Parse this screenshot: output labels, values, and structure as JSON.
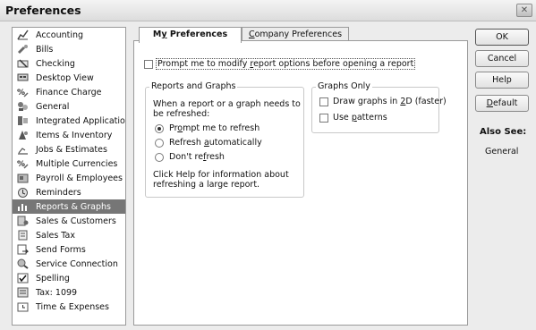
{
  "window": {
    "title": "Preferences",
    "close_glyph": "✕"
  },
  "sidebar": {
    "items": [
      {
        "label": "Accounting",
        "icon": "accounting-icon"
      },
      {
        "label": "Bills",
        "icon": "bills-icon"
      },
      {
        "label": "Checking",
        "icon": "checking-icon"
      },
      {
        "label": "Desktop View",
        "icon": "desktop-view-icon"
      },
      {
        "label": "Finance Charge",
        "icon": "finance-charge-icon"
      },
      {
        "label": "General",
        "icon": "general-icon"
      },
      {
        "label": "Integrated Applications",
        "icon": "integrated-apps-icon"
      },
      {
        "label": "Items & Inventory",
        "icon": "items-inventory-icon"
      },
      {
        "label": "Jobs & Estimates",
        "icon": "jobs-estimates-icon"
      },
      {
        "label": "Multiple Currencies",
        "icon": "currencies-icon"
      },
      {
        "label": "Payroll & Employees",
        "icon": "payroll-icon"
      },
      {
        "label": "Reminders",
        "icon": "reminders-icon"
      },
      {
        "label": "Reports & Graphs",
        "icon": "reports-graphs-icon"
      },
      {
        "label": "Sales & Customers",
        "icon": "sales-customers-icon"
      },
      {
        "label": "Sales Tax",
        "icon": "sales-tax-icon"
      },
      {
        "label": "Send Forms",
        "icon": "send-forms-icon"
      },
      {
        "label": "Service Connection",
        "icon": "service-connection-icon"
      },
      {
        "label": "Spelling",
        "icon": "spelling-icon"
      },
      {
        "label": "Tax: 1099",
        "icon": "tax-1099-icon"
      },
      {
        "label": "Time & Expenses",
        "icon": "time-expenses-icon"
      }
    ],
    "selected": "Reports & Graphs"
  },
  "tabs": {
    "my_pre": "M",
    "my_u": "y",
    "my_post": " Preferences",
    "company_u": "C",
    "company_post": "ompany Preferences"
  },
  "prompt_modify": {
    "pre": "Prompt me to modify ",
    "u": "r",
    "post": "eport options before opening a report",
    "checked": false
  },
  "reports_graphs": {
    "legend": "Reports and Graphs",
    "question_line1": "When a report or a graph needs to",
    "question_line2": "be refreshed:",
    "options": [
      {
        "pre": "Pr",
        "u": "o",
        "post": "mpt me to refresh",
        "selected": true
      },
      {
        "pre": "Refresh ",
        "u": "a",
        "post": "utomatically",
        "selected": false
      },
      {
        "pre": "Don't re",
        "u": "f",
        "post": "resh",
        "selected": false
      }
    ],
    "help_line1": "Click Help for information about",
    "help_line2": "refreshing a large report."
  },
  "graphs_only": {
    "legend": "Graphs Only",
    "draw2d": {
      "pre": "Draw graphs in ",
      "u": "2",
      "post": "D (faster)",
      "checked": false
    },
    "patterns": {
      "pre": "Use ",
      "u": "p",
      "post": "atterns",
      "checked": false
    }
  },
  "buttons": {
    "ok": "OK",
    "cancel": "Cancel",
    "help": "Help",
    "default_u": "D",
    "default_post": "efault"
  },
  "also_see": {
    "heading": "Also See:",
    "link": "General"
  }
}
